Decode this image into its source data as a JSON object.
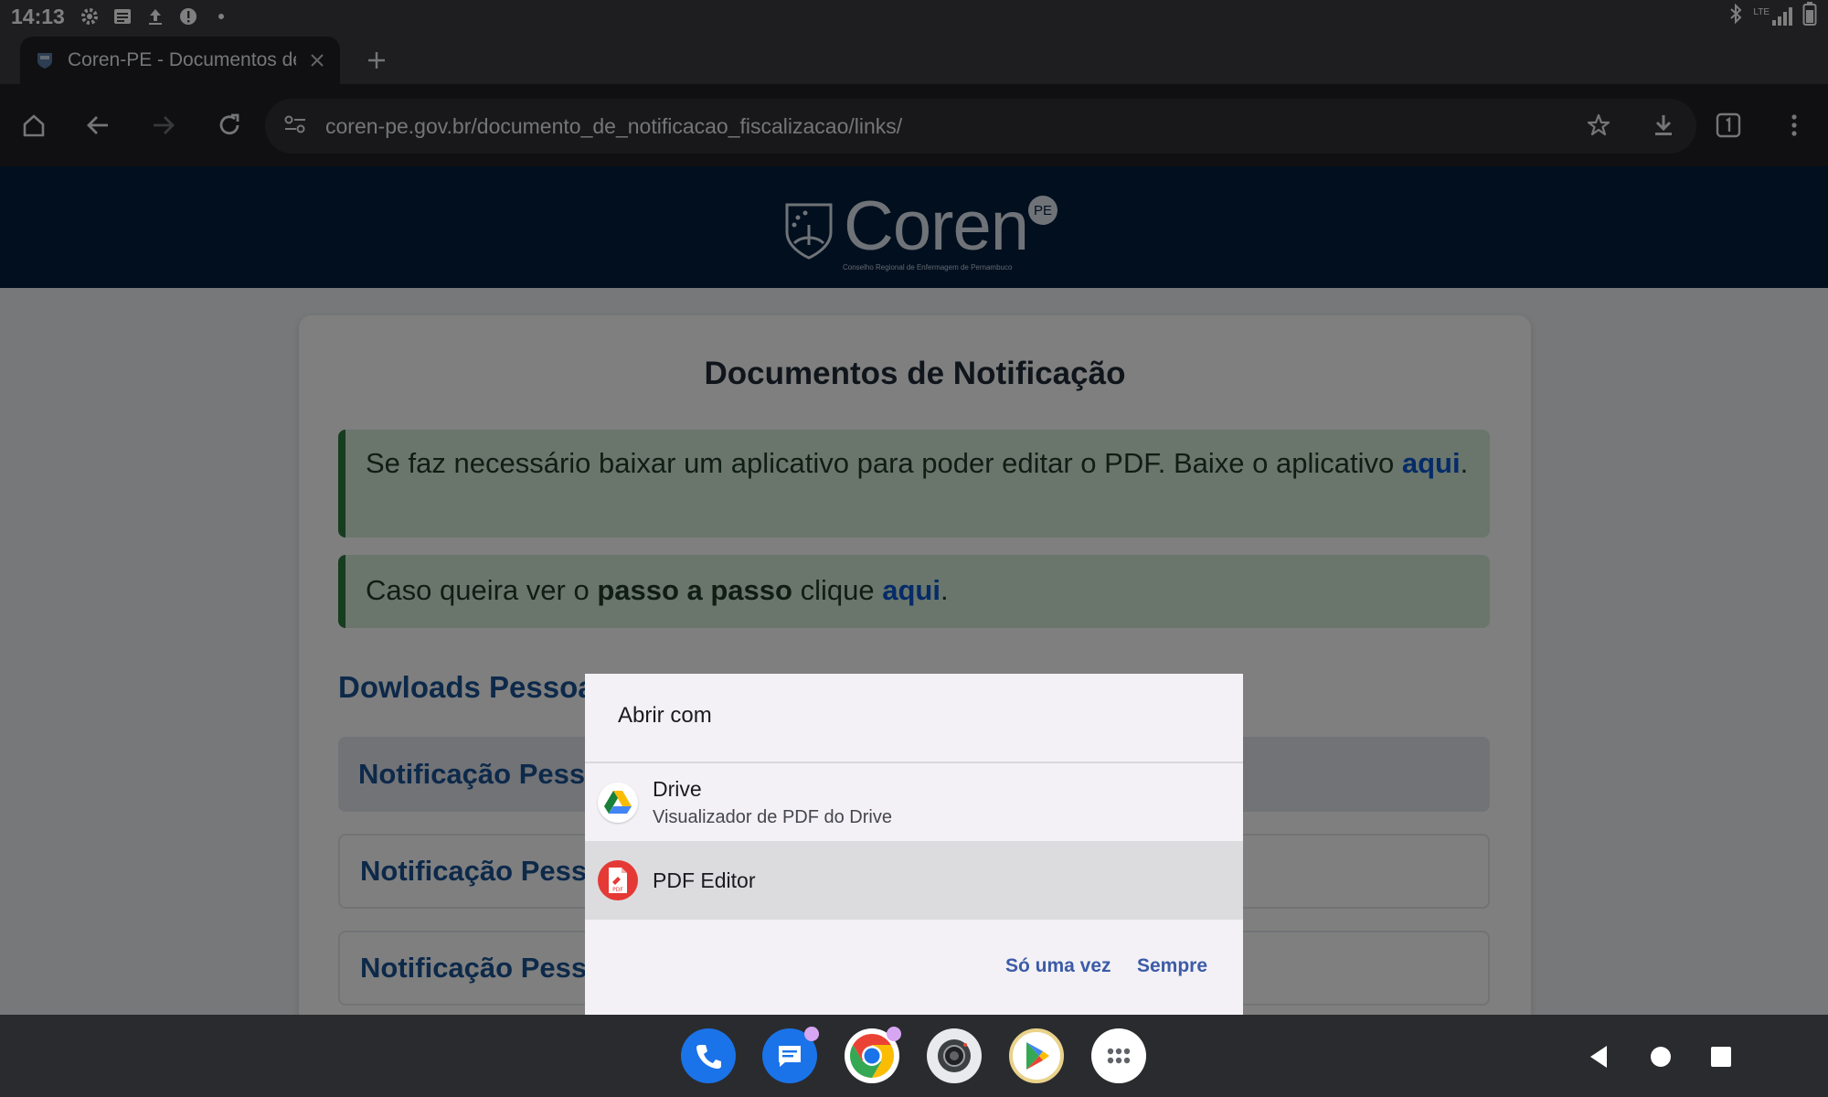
{
  "status_bar": {
    "time": "14:13",
    "left_icons": [
      "gear-icon",
      "news-icon",
      "upload-icon",
      "alert-icon",
      "dot-icon"
    ],
    "right_icons": [
      "bluetooth-icon",
      "lte-signal-icon",
      "battery-icon"
    ],
    "network_label": "LTE"
  },
  "browser": {
    "tab": {
      "title": "Coren-PE - Documentos de Notificação"
    },
    "new_tab_label": "+",
    "url": "coren-pe.gov.br/documento_de_notificacao_fiscalizacao/links/"
  },
  "page": {
    "logo_text": "Coren",
    "logo_badge": "PE",
    "logo_subtitle": "Conselho Regional de Enfermagem de Pernambuco",
    "title": "Documentos de Notificação",
    "alert1": {
      "text": "Se faz necessário baixar um aplicativo para poder editar o PDF. Baixe o aplicativo ",
      "link": "aqui",
      "end": "."
    },
    "alert2": {
      "pre": "Caso queira ver o ",
      "bold": "passo a passo",
      "mid": " clique ",
      "link": "aqui",
      "end": "."
    },
    "section_title": "Dowloads Pessoa",
    "items": [
      "Notificação Pesso",
      "Notificação Pesso",
      "Notificação Pesso"
    ]
  },
  "dialog": {
    "title": "Abrir com",
    "options": [
      {
        "name": "Drive",
        "subtitle": "Visualizador de PDF do Drive",
        "icon": "google-drive-icon"
      },
      {
        "name": "PDF Editor",
        "subtitle": "",
        "icon": "pdf-editor-icon",
        "icon_label": "PDF"
      }
    ],
    "once_label": "Só uma vez",
    "always_label": "Sempre"
  },
  "taskbar": {
    "apps": [
      "phone-icon",
      "messages-icon",
      "chrome-icon",
      "camera-icon",
      "play-store-icon",
      "app-drawer-icon"
    ],
    "nav": [
      "back-icon",
      "home-icon",
      "recents-icon"
    ]
  },
  "colors": {
    "site_header": "#021f3f",
    "alert_bg": "#d4ecd9",
    "alert_border": "#2d7a3e",
    "link": "#0b57d0",
    "section_blue": "#1a5394",
    "dialog_bg": "#f3f1f5",
    "dialog_button": "#3c5ba8"
  }
}
